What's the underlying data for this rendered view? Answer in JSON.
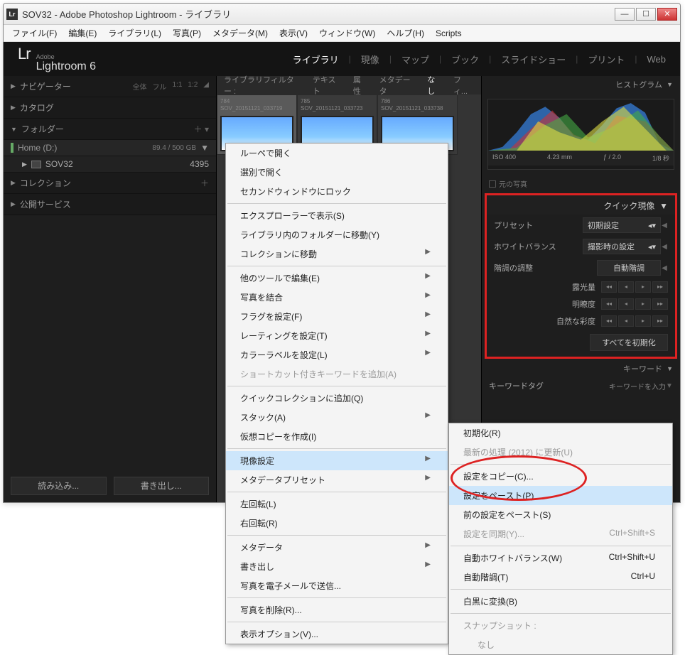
{
  "window": {
    "title": "SOV32 - Adobe Photoshop Lightroom - ライブラリ",
    "app_icon": "Lr"
  },
  "menubar": {
    "file": "ファイル(F)",
    "edit": "編集(E)",
    "library": "ライブラリ(L)",
    "photo": "写真(P)",
    "metadata": "メタデータ(M)",
    "view": "表示(V)",
    "window": "ウィンドウ(W)",
    "help": "ヘルプ(H)",
    "scripts": "Scripts"
  },
  "logo": {
    "lr": "Lr",
    "adobe": "Adobe",
    "name": "Lightroom 6"
  },
  "modules": {
    "library": "ライブラリ",
    "develop": "現像",
    "map": "マップ",
    "book": "ブック",
    "slideshow": "スライドショー",
    "print": "プリント",
    "web": "Web"
  },
  "left": {
    "navigator": "ナビゲーター",
    "nav_opts": {
      "a": "全体",
      "b": "フル",
      "c": "1:1",
      "d": "1:2"
    },
    "catalog": "カタログ",
    "folders": "フォルダー",
    "drive": "Home (D:)",
    "drive_usage": "89.4 / 500 GB",
    "folder": "SOV32",
    "folder_count": "4395",
    "collections": "コレクション",
    "publish": "公開サービス",
    "import": "読み込み...",
    "export": "書き出し..."
  },
  "filter": {
    "label": "ライブラリフィルター :",
    "text": "テキスト",
    "attr": "属性",
    "meta": "メタデータ",
    "none": "なし",
    "fil": "フィ..."
  },
  "thumbs": [
    {
      "num": "784",
      "name": "SOV_20151121_033719"
    },
    {
      "num": "785",
      "name": "SOV_20151121_033723"
    },
    {
      "num": "786",
      "name": "SOV_20151121_033738"
    }
  ],
  "right": {
    "histogram": "ヒストグラム",
    "iso": "ISO 400",
    "focal": "4.23 mm",
    "fstop": "ƒ / 2.0",
    "shutter": "1/8 秒",
    "original": "元の写真",
    "quick_dev": "クイック現像",
    "preset_lbl": "プリセット",
    "preset_val": "初期設定",
    "wb_lbl": "ホワイトバランス",
    "wb_val": "撮影時の設定",
    "tone_lbl": "階調の調整",
    "auto_tone": "自動階調",
    "exposure": "露光量",
    "clarity": "明瞭度",
    "vibrance": "自然な彩度",
    "reset_all": "すべてを初期化",
    "keywords": "キーワード",
    "kw_tag": "キーワードタグ",
    "kw_enter": "キーワードを入力"
  },
  "ctx1": {
    "open_loupe": "ルーペで開く",
    "open_sort": "選別で開く",
    "lock_2nd": "セカンドウィンドウにロック",
    "show_explorer": "エクスプローラーで表示(S)",
    "goto_folder": "ライブラリ内のフォルダーに移動(Y)",
    "goto_collection": "コレクションに移動",
    "edit_in": "他のツールで編集(E)",
    "merge": "写真を結合",
    "set_flag": "フラグを設定(F)",
    "set_rating": "レーティングを設定(T)",
    "set_label": "カラーラベルを設定(L)",
    "add_kw": "ショートカット付きキーワードを追加(A)",
    "quick_coll": "クイックコレクションに追加(Q)",
    "stack": "スタック(A)",
    "virtual_copy": "仮想コピーを作成(I)",
    "develop_settings": "現像設定",
    "meta_preset": "メタデータプリセット",
    "rotate_left": "左回転(L)",
    "rotate_right": "右回転(R)",
    "metadata": "メタデータ",
    "export": "書き出し",
    "email": "写真を電子メールで送信...",
    "delete": "写真を削除(R)...",
    "view_opts": "表示オプション(V)..."
  },
  "ctx2": {
    "reset": "初期化(R)",
    "update_2012": "最新の処理 (2012) に更新(U)",
    "copy": "設定をコピー(C)...",
    "paste": "設定をペースト(P)",
    "paste_prev": "前の設定をペースト(S)",
    "sync": "設定を同期(Y)...",
    "sync_key": "Ctrl+Shift+S",
    "auto_wb": "自動ホワイトバランス(W)",
    "auto_wb_key": "Ctrl+Shift+U",
    "auto_tone": "自動階調(T)",
    "auto_tone_key": "Ctrl+U",
    "bw": "白黒に変換(B)",
    "snapshot": "スナップショット :",
    "snap_none": "なし"
  }
}
